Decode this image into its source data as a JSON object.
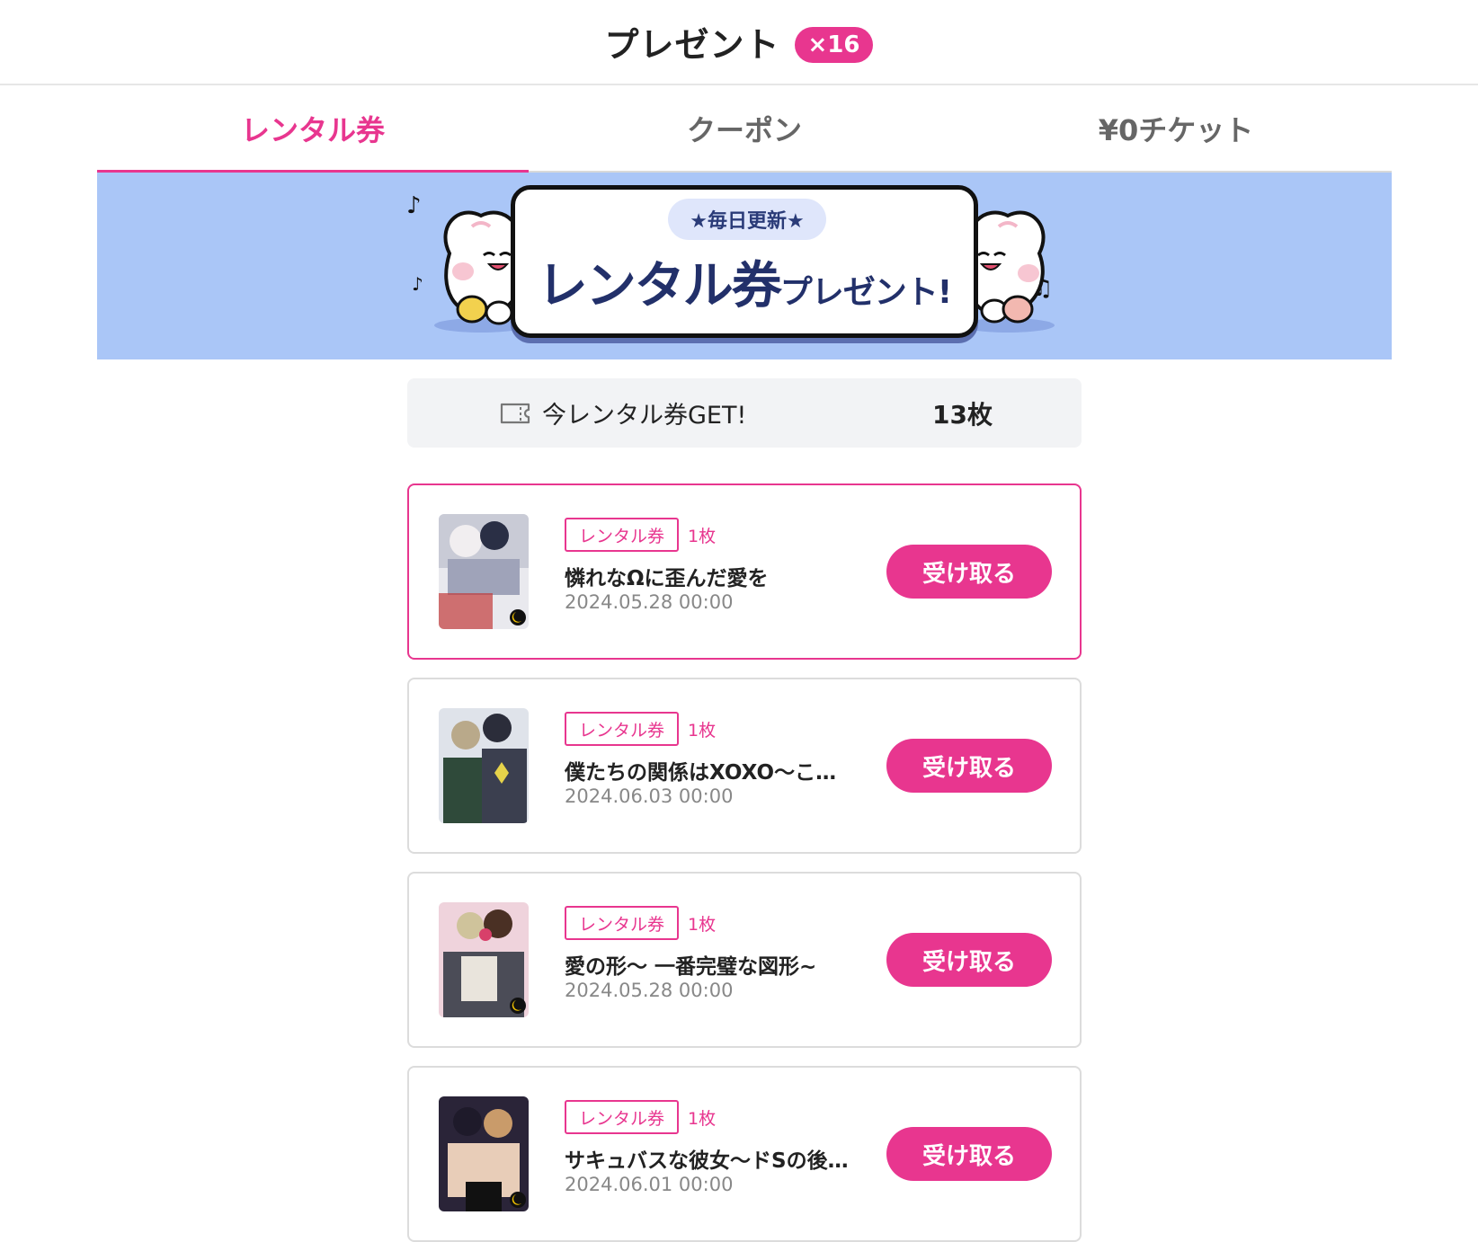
{
  "header": {
    "title": "プレゼント",
    "badge": "×16"
  },
  "tabs": [
    {
      "label": "レンタル券",
      "active": true
    },
    {
      "label": "クーポン",
      "active": false
    },
    {
      "label": "¥0チケット",
      "active": false
    }
  ],
  "banner": {
    "pill_text": "★毎日更新★",
    "main_big": "レンタル券",
    "main_small": "プレゼント!",
    "background_color": "#aac6f7"
  },
  "stats": {
    "label": "今レンタル券GET!",
    "count": "13枚"
  },
  "items": [
    {
      "tag": "レンタル券",
      "count": "1枚",
      "title": "憐れなΩに歪んだ愛を",
      "date": "2024.05.28 00:00",
      "button": "受け取る",
      "selected": true
    },
    {
      "tag": "レンタル券",
      "count": "1枚",
      "title": "僕たちの関係はXOXO〜こ…",
      "date": "2024.06.03 00:00",
      "button": "受け取る",
      "selected": false
    },
    {
      "tag": "レンタル券",
      "count": "1枚",
      "title": "愛の形〜 一番完璧な図形~",
      "date": "2024.05.28 00:00",
      "button": "受け取る",
      "selected": false
    },
    {
      "tag": "レンタル券",
      "count": "1枚",
      "title": "サキュバスな彼女〜ドSの後…",
      "date": "2024.06.01 00:00",
      "button": "受け取る",
      "selected": false
    }
  ],
  "colors": {
    "accent": "#e8368f",
    "banner_bg": "#aac6f7",
    "stats_bg": "#f2f3f5"
  }
}
